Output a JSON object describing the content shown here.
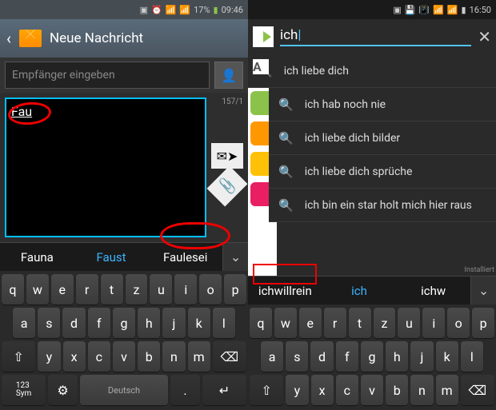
{
  "left": {
    "status": {
      "battery": "17%",
      "time": "09:46"
    },
    "header_title": "Neue Nachricht",
    "recipient_placeholder": "Empfänger eingeben",
    "message_text": "Fau",
    "char_count": "157/1",
    "suggestions": [
      "Fauna",
      "Faust",
      "Faulesei"
    ],
    "keyboard": {
      "row1": [
        "q",
        "w",
        "e",
        "r",
        "t",
        "z",
        "u",
        "i",
        "o",
        "p"
      ],
      "row2": [
        "a",
        "s",
        "d",
        "f",
        "g",
        "h",
        "j",
        "k",
        "l"
      ],
      "row3_shift": "⇧",
      "row3": [
        "y",
        "x",
        "c",
        "v",
        "b",
        "n",
        "m"
      ],
      "row3_del": "⌫",
      "row4_sym": "123\nSym",
      "row4_set": "⚙",
      "row4_space": "Deutsch",
      "row4_dot": ".",
      "row4_enter": "↵"
    }
  },
  "right": {
    "status": {
      "time": "16:50"
    },
    "search_query": "ich",
    "results": [
      "ich liebe dich",
      "ich hab noch nie",
      "ich liebe dich bilder",
      "ich liebe dich sprüche",
      "ich bin ein star holt mich hier raus"
    ],
    "installed_label": "Installiert",
    "suggestions": [
      "ichwillrein",
      "ich",
      "ichw"
    ],
    "keyboard": {
      "row1": [
        "q",
        "w",
        "e",
        "r",
        "t",
        "z",
        "u",
        "i",
        "o",
        "p"
      ],
      "row2": [
        "a",
        "s",
        "d",
        "f",
        "g",
        "h",
        "j",
        "k",
        "l"
      ],
      "row3_shift": "⇧",
      "row3": [
        "y",
        "x",
        "c",
        "v",
        "b",
        "n",
        "m"
      ],
      "row3_del": "⌫"
    }
  }
}
